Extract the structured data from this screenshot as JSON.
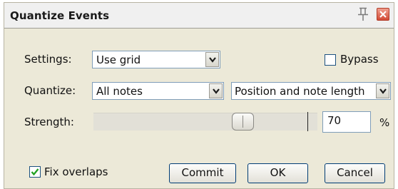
{
  "window": {
    "title": "Quantize Events",
    "pin_icon": "pin-icon",
    "close_icon": "close-icon"
  },
  "settings": {
    "label": "Settings:",
    "value": "Use grid"
  },
  "bypass": {
    "label": "Bypass",
    "checked": false
  },
  "quantize": {
    "label": "Quantize:",
    "value": "All notes",
    "mode_value": "Position and note length"
  },
  "strength": {
    "label": "Strength:",
    "value": "70",
    "unit": "%",
    "slider_fraction": 0.7
  },
  "fix_overlaps": {
    "label": "Fix overlaps",
    "checked": true
  },
  "buttons": {
    "commit": "Commit",
    "ok": "OK",
    "cancel": "Cancel"
  },
  "colors": {
    "dialog_bg": "#ece9d8",
    "close_button": "#d24a35",
    "check_mark": "#21a121",
    "button_border": "#003c74"
  }
}
